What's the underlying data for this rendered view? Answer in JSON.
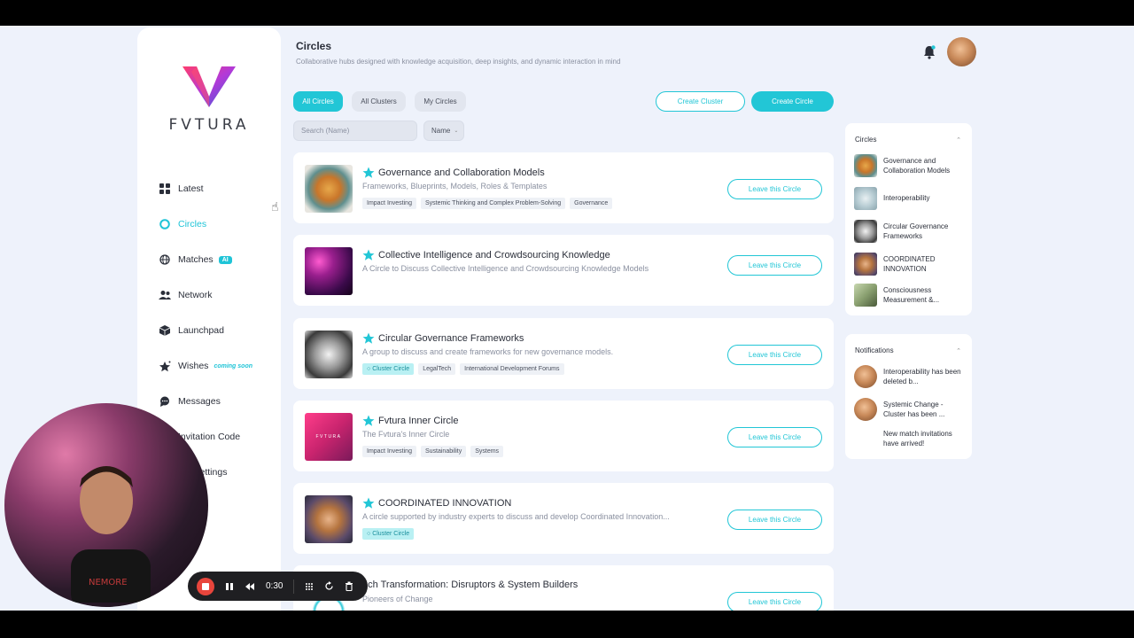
{
  "brand": {
    "name": "FVTURA",
    "accent": "#22c6d6"
  },
  "sidebar": {
    "items": [
      {
        "label": "Latest",
        "icon": "grid-icon"
      },
      {
        "label": "Circles",
        "icon": "circle-icon",
        "active": true
      },
      {
        "label": "Matches",
        "icon": "globe-icon",
        "badge": "AI"
      },
      {
        "label": "Network",
        "icon": "people-icon"
      },
      {
        "label": "Launchpad",
        "icon": "cube-icon"
      },
      {
        "label": "Wishes",
        "icon": "stars-icon",
        "badge": "coming soon"
      },
      {
        "label": "Messages",
        "icon": "chat-icon"
      },
      {
        "label": "Invitation Code",
        "icon": "ticket-icon"
      },
      {
        "label": "ork Settings",
        "icon": "gear-icon"
      }
    ]
  },
  "header": {
    "title": "Circles",
    "subtitle": "Collaborative hubs designed with knowledge acquisition, deep insights, and dynamic interaction in mind"
  },
  "filters": {
    "tabs": [
      "All Circles",
      "All Clusters",
      "My Circles"
    ],
    "create_cluster": "Create Cluster",
    "create_circle": "Create Circle",
    "search_placeholder": "Search (Name)",
    "sort_value": "Name"
  },
  "circles": [
    {
      "title": "Governance and Collaboration Models",
      "desc": "Frameworks, Blueprints, Models, Roles & Templates",
      "tags": [
        "Impact Investing",
        "Systemic Thinking and Complex Problem-Solving",
        "Governance"
      ],
      "action": "Leave this Circle"
    },
    {
      "title": "Collective Intelligence and Crowdsourcing Knowledge",
      "desc": "A Circle to Discuss Collective Intelligence and Crowdsourcing Knowledge Models",
      "tags": [],
      "action": "Leave this Circle"
    },
    {
      "title": "Circular Governance Frameworks",
      "desc": "A group to discuss and create frameworks for new governance models.",
      "tags": [
        "Cluster Circle",
        "LegalTech",
        "International Development Forums"
      ],
      "action": "Leave this Circle"
    },
    {
      "title": "Fvtura Inner Circle",
      "desc": "The Fvtura's Inner Circle",
      "tags": [
        "Impact Investing",
        "Sustainability",
        "Systems"
      ],
      "action": "Leave this Circle",
      "thumb_text": "FVTURA"
    },
    {
      "title": "COORDINATED INNOVATION",
      "desc": "A circle supported by industry experts to discuss and develop Coordinated Innovation...",
      "tags": [
        "Cluster Circle"
      ],
      "action": "Leave this Circle"
    },
    {
      "title": "ech Transformation: Disruptors & System Builders",
      "desc": "Pioneers of Change",
      "tags": [],
      "action": "Leave this Circle"
    }
  ],
  "right_circles": {
    "title": "Circles",
    "items": [
      "Governance and Collaboration Models",
      "Interoperability",
      "Circular Governance Frameworks",
      "COORDINATED INNOVATION",
      "Consciousness Measurement &..."
    ]
  },
  "notifications": {
    "title": "Notifications",
    "items": [
      "Interoperability has been deleted b...",
      "Systemic Change - Cluster has been ...",
      "New match invitations have arrived!"
    ]
  },
  "recorder": {
    "time": "0:30"
  }
}
